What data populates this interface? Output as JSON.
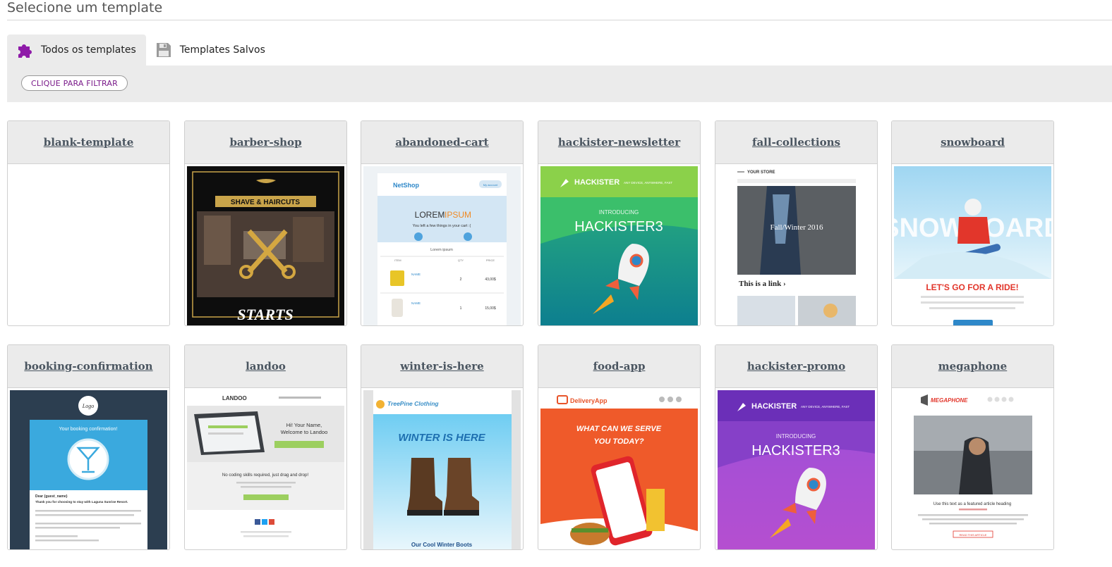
{
  "page": {
    "title": "Selecione um template"
  },
  "tabs": [
    {
      "label": "Todos os templates",
      "icon": "puzzle-icon",
      "active": true
    },
    {
      "label": "Templates Salvos",
      "icon": "floppy-disk-icon",
      "active": false
    }
  ],
  "filter": {
    "button_label": "CLIQUE PARA FILTRAR"
  },
  "colors": {
    "accent": "#8e1aa8",
    "header_bg": "#ebebeb",
    "filter_text": "#7a1a8a"
  },
  "templates": [
    {
      "name": "blank-template"
    },
    {
      "name": "barber-shop",
      "thumb": {
        "badge": "SHAVE & HAIRCUTS",
        "caption": "STARTS"
      }
    },
    {
      "name": "abandoned-cart",
      "thumb": {
        "brand": "NetShop",
        "tag": "My account",
        "headline_a": "LOREM",
        "headline_b": "IPSUM",
        "sub": "You left a few things in your cart :(",
        "section": "Lorem ipsum",
        "col_item": "ITEM",
        "col_qty": "QTY",
        "col_price": "PRICE",
        "row1_name": "NAME",
        "row1_qty": "2",
        "row1_price": "43,00$",
        "row2_name": "NAME",
        "row2_qty": "1",
        "row2_price": "15,00$"
      }
    },
    {
      "name": "hackister-newsletter",
      "thumb": {
        "brand": "HACKISTER",
        "tagline": "ANY DEVICE, ANYWHERE, FAST",
        "intro": "INTRODUCING",
        "product": "HACKISTER3"
      }
    },
    {
      "name": "fall-collections",
      "thumb": {
        "store": "YOUR STORE",
        "season": "Fall/Winter 2016",
        "link": "This is a link ›"
      }
    },
    {
      "name": "snowboard",
      "thumb": {
        "word": "SNOWBOARD",
        "cta": "LET'S GO FOR A RIDE!"
      }
    },
    {
      "name": "booking-confirmation",
      "thumb": {
        "logo": "Logo",
        "banner": "Your booking confirmation!",
        "greeting": "Dear {guest_name}",
        "thanks": "Thank you for choosing to stay with Laguna Sunrise Resort."
      }
    },
    {
      "name": "landoo",
      "thumb": {
        "brand": "LANDOO",
        "hello": "Hi! Your Name,",
        "welcome": "Welcome to Landoo",
        "nocode": "No coding skills required, just drag and drop!"
      }
    },
    {
      "name": "winter-is-here",
      "thumb": {
        "brand": "TreePine Clothing",
        "headline": "WINTER IS HERE",
        "caption": "Our Cool Winter Boots"
      }
    },
    {
      "name": "food-app",
      "thumb": {
        "brand": "DeliveryApp",
        "headline1": "WHAT CAN WE SERVE",
        "headline2": "YOU TODAY?"
      }
    },
    {
      "name": "hackister-promo",
      "thumb": {
        "brand": "HACKISTER",
        "tagline": "ANY DEVICE, ANYWHERE, FAST",
        "intro": "INTRODUCING",
        "product": "HACKISTER3"
      }
    },
    {
      "name": "megaphone",
      "thumb": {
        "brand": "MEGAPHONE",
        "heading": "Use this text as a featured article heading",
        "button": "READ THIS ARTICLE"
      }
    }
  ]
}
